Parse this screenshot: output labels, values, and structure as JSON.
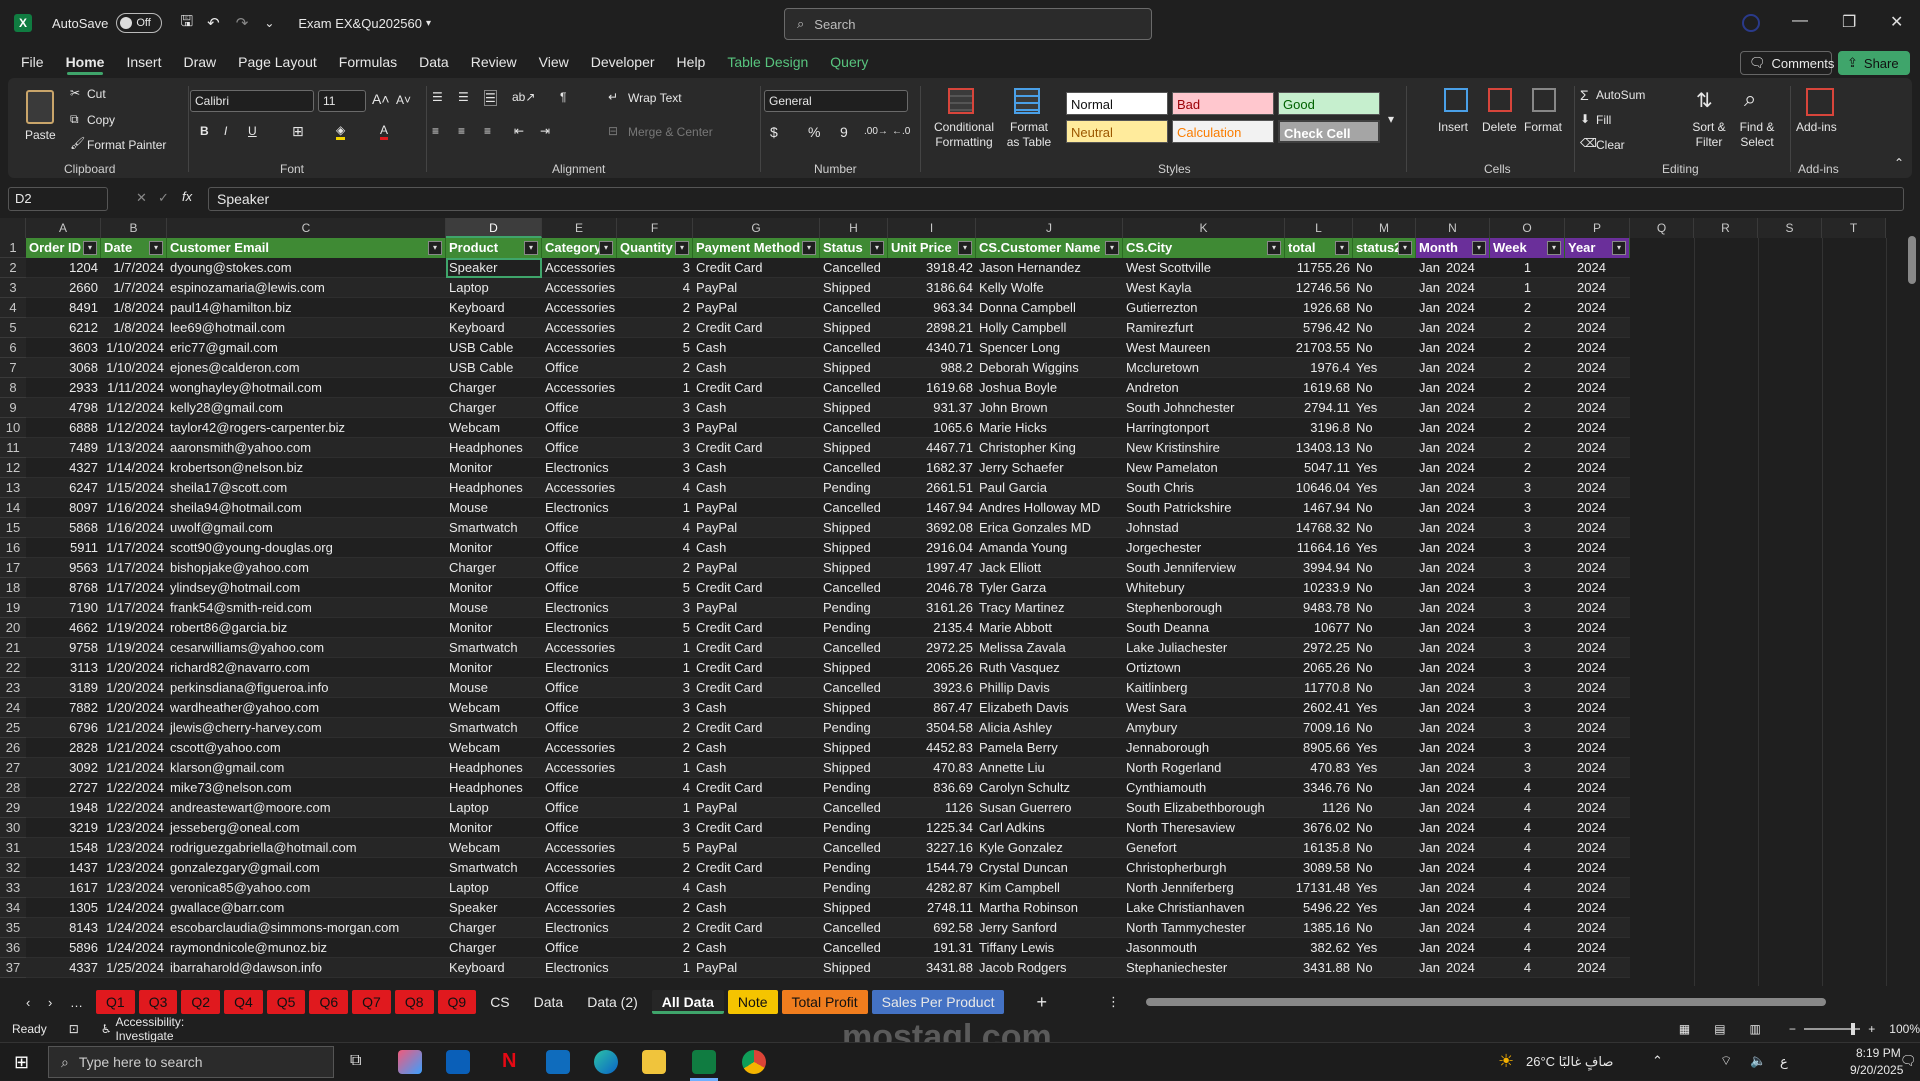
{
  "titlebar": {
    "autosave_label": "AutoSave",
    "autosave_state": "Off",
    "file_name": "Exam EX&Qu202560",
    "search_placeholder": "Search"
  },
  "menu": {
    "items": [
      "File",
      "Home",
      "Insert",
      "Draw",
      "Page Layout",
      "Formulas",
      "Data",
      "Review",
      "View",
      "Developer",
      "Help"
    ],
    "context": [
      "Table Design",
      "Query"
    ],
    "comments": "Comments",
    "share": "Share"
  },
  "ribbon": {
    "clipboard": {
      "paste": "Paste",
      "cut": "Cut",
      "copy": "Copy",
      "format_painter": "Format Painter",
      "label": "Clipboard"
    },
    "font": {
      "name": "Calibri",
      "size": "11",
      "label": "Font"
    },
    "alignment": {
      "wrap": "Wrap Text",
      "merge": "Merge & Center",
      "label": "Alignment"
    },
    "number": {
      "format": "General",
      "label": "Number"
    },
    "styles": {
      "conditional": "Conditional Formatting",
      "format_table": "Format as Table",
      "normal": "Normal",
      "bad": "Bad",
      "good": "Good",
      "neutral": "Neutral",
      "calculation": "Calculation",
      "check": "Check Cell",
      "label": "Styles"
    },
    "cells": {
      "insert": "Insert",
      "delete": "Delete",
      "format": "Format",
      "label": "Cells"
    },
    "editing": {
      "autosum": "AutoSum",
      "fill": "Fill",
      "clear": "Clear",
      "sort": "Sort & Filter",
      "find": "Find & Select",
      "label": "Editing"
    },
    "addins": {
      "addins": "Add-ins",
      "label": "Add-ins"
    }
  },
  "formula_bar": {
    "name_box": "D2",
    "formula": "Speaker"
  },
  "columns": [
    "A",
    "B",
    "C",
    "D",
    "E",
    "F",
    "G",
    "H",
    "I",
    "J",
    "K",
    "L",
    "M",
    "N",
    "O",
    "P",
    "Q",
    "R",
    "S",
    "T"
  ],
  "headers": [
    "Order ID",
    "Date",
    "Customer Email",
    "Product",
    "Category",
    "Quantity",
    "Payment Method",
    "Status",
    "Unit Price",
    "CS.Customer Name",
    "CS.City",
    "total",
    "status2",
    "Month",
    "Week",
    "Year"
  ],
  "rows": [
    [
      "1204",
      "1/7/2024",
      "dyoung@stokes.com",
      "Speaker",
      "Accessories",
      "3",
      "Credit Card",
      "Cancelled",
      "3918.42",
      "Jason Hernandez",
      "West Scottville",
      "11755.26",
      "No",
      "Jan",
      "2024",
      "1",
      "2024"
    ],
    [
      "2660",
      "1/7/2024",
      "espinozamaria@lewis.com",
      "Laptop",
      "Accessories",
      "4",
      "PayPal",
      "Shipped",
      "3186.64",
      "Kelly Wolfe",
      "West Kayla",
      "12746.56",
      "No",
      "Jan",
      "2024",
      "1",
      "2024"
    ],
    [
      "8491",
      "1/8/2024",
      "paul14@hamilton.biz",
      "Keyboard",
      "Accessories",
      "2",
      "PayPal",
      "Cancelled",
      "963.34",
      "Donna Campbell",
      "Gutierrezton",
      "1926.68",
      "No",
      "Jan",
      "2024",
      "2",
      "2024"
    ],
    [
      "6212",
      "1/8/2024",
      "lee69@hotmail.com",
      "Keyboard",
      "Accessories",
      "2",
      "Credit Card",
      "Shipped",
      "2898.21",
      "Holly Campbell",
      "Ramirezfurt",
      "5796.42",
      "No",
      "Jan",
      "2024",
      "2",
      "2024"
    ],
    [
      "3603",
      "1/10/2024",
      "eric77@gmail.com",
      "USB Cable",
      "Accessories",
      "5",
      "Cash",
      "Cancelled",
      "4340.71",
      "Spencer Long",
      "West Maureen",
      "21703.55",
      "No",
      "Jan",
      "2024",
      "2",
      "2024"
    ],
    [
      "3068",
      "1/10/2024",
      "ejones@calderon.com",
      "USB Cable",
      "Office",
      "2",
      "Cash",
      "Shipped",
      "988.2",
      "Deborah Wiggins",
      "Mccluretown",
      "1976.4",
      "Yes",
      "Jan",
      "2024",
      "2",
      "2024"
    ],
    [
      "2933",
      "1/11/2024",
      "wonghayley@hotmail.com",
      "Charger",
      "Accessories",
      "1",
      "Credit Card",
      "Cancelled",
      "1619.68",
      "Joshua Boyle",
      "Andreton",
      "1619.68",
      "No",
      "Jan",
      "2024",
      "2",
      "2024"
    ],
    [
      "4798",
      "1/12/2024",
      "kelly28@gmail.com",
      "Charger",
      "Office",
      "3",
      "Cash",
      "Shipped",
      "931.37",
      "John Brown",
      "South Johnchester",
      "2794.11",
      "Yes",
      "Jan",
      "2024",
      "2",
      "2024"
    ],
    [
      "6888",
      "1/12/2024",
      "taylor42@rogers-carpenter.biz",
      "Webcam",
      "Office",
      "3",
      "PayPal",
      "Cancelled",
      "1065.6",
      "Marie Hicks",
      "Harringtonport",
      "3196.8",
      "No",
      "Jan",
      "2024",
      "2",
      "2024"
    ],
    [
      "7489",
      "1/13/2024",
      "aaronsmith@yahoo.com",
      "Headphones",
      "Office",
      "3",
      "Credit Card",
      "Shipped",
      "4467.71",
      "Christopher King",
      "New Kristinshire",
      "13403.13",
      "No",
      "Jan",
      "2024",
      "2",
      "2024"
    ],
    [
      "4327",
      "1/14/2024",
      "krobertson@nelson.biz",
      "Monitor",
      "Electronics",
      "3",
      "Cash",
      "Cancelled",
      "1682.37",
      "Jerry Schaefer",
      "New Pamelaton",
      "5047.11",
      "Yes",
      "Jan",
      "2024",
      "2",
      "2024"
    ],
    [
      "6247",
      "1/15/2024",
      "sheila17@scott.com",
      "Headphones",
      "Accessories",
      "4",
      "Cash",
      "Pending",
      "2661.51",
      "Paul Garcia",
      "South Chris",
      "10646.04",
      "Yes",
      "Jan",
      "2024",
      "3",
      "2024"
    ],
    [
      "8097",
      "1/16/2024",
      "sheila94@hotmail.com",
      "Mouse",
      "Electronics",
      "1",
      "PayPal",
      "Cancelled",
      "1467.94",
      "Andres Holloway MD",
      "South Patrickshire",
      "1467.94",
      "No",
      "Jan",
      "2024",
      "3",
      "2024"
    ],
    [
      "5868",
      "1/16/2024",
      "uwolf@gmail.com",
      "Smartwatch",
      "Office",
      "4",
      "PayPal",
      "Shipped",
      "3692.08",
      "Erica Gonzales MD",
      "Johnstad",
      "14768.32",
      "No",
      "Jan",
      "2024",
      "3",
      "2024"
    ],
    [
      "5911",
      "1/17/2024",
      "scott90@young-douglas.org",
      "Monitor",
      "Office",
      "4",
      "Cash",
      "Shipped",
      "2916.04",
      "Amanda Young",
      "Jorgechester",
      "11664.16",
      "Yes",
      "Jan",
      "2024",
      "3",
      "2024"
    ],
    [
      "9563",
      "1/17/2024",
      "bishopjake@yahoo.com",
      "Charger",
      "Office",
      "2",
      "PayPal",
      "Shipped",
      "1997.47",
      "Jack Elliott",
      "South Jenniferview",
      "3994.94",
      "No",
      "Jan",
      "2024",
      "3",
      "2024"
    ],
    [
      "8768",
      "1/17/2024",
      "ylindsey@hotmail.com",
      "Monitor",
      "Office",
      "5",
      "Credit Card",
      "Cancelled",
      "2046.78",
      "Tyler Garza",
      "Whitebury",
      "10233.9",
      "No",
      "Jan",
      "2024",
      "3",
      "2024"
    ],
    [
      "7190",
      "1/17/2024",
      "frank54@smith-reid.com",
      "Mouse",
      "Electronics",
      "3",
      "PayPal",
      "Pending",
      "3161.26",
      "Tracy Martinez",
      "Stephenborough",
      "9483.78",
      "No",
      "Jan",
      "2024",
      "3",
      "2024"
    ],
    [
      "4662",
      "1/19/2024",
      "robert86@garcia.biz",
      "Monitor",
      "Electronics",
      "5",
      "Credit Card",
      "Pending",
      "2135.4",
      "Marie Abbott",
      "South Deanna",
      "10677",
      "No",
      "Jan",
      "2024",
      "3",
      "2024"
    ],
    [
      "9758",
      "1/19/2024",
      "cesarwilliams@yahoo.com",
      "Smartwatch",
      "Accessories",
      "1",
      "Credit Card",
      "Cancelled",
      "2972.25",
      "Melissa Zavala",
      "Lake Juliachester",
      "2972.25",
      "No",
      "Jan",
      "2024",
      "3",
      "2024"
    ],
    [
      "3113",
      "1/20/2024",
      "richard82@navarro.com",
      "Monitor",
      "Electronics",
      "1",
      "Credit Card",
      "Shipped",
      "2065.26",
      "Ruth Vasquez",
      "Ortiztown",
      "2065.26",
      "No",
      "Jan",
      "2024",
      "3",
      "2024"
    ],
    [
      "3189",
      "1/20/2024",
      "perkinsdiana@figueroa.info",
      "Mouse",
      "Office",
      "3",
      "Credit Card",
      "Cancelled",
      "3923.6",
      "Phillip Davis",
      "Kaitlinberg",
      "11770.8",
      "No",
      "Jan",
      "2024",
      "3",
      "2024"
    ],
    [
      "7882",
      "1/20/2024",
      "wardheather@yahoo.com",
      "Webcam",
      "Office",
      "3",
      "Cash",
      "Shipped",
      "867.47",
      "Elizabeth Davis",
      "West Sara",
      "2602.41",
      "Yes",
      "Jan",
      "2024",
      "3",
      "2024"
    ],
    [
      "6796",
      "1/21/2024",
      "jlewis@cherry-harvey.com",
      "Smartwatch",
      "Office",
      "2",
      "Credit Card",
      "Pending",
      "3504.58",
      "Alicia Ashley",
      "Amybury",
      "7009.16",
      "No",
      "Jan",
      "2024",
      "3",
      "2024"
    ],
    [
      "2828",
      "1/21/2024",
      "cscott@yahoo.com",
      "Webcam",
      "Accessories",
      "2",
      "Cash",
      "Shipped",
      "4452.83",
      "Pamela Berry",
      "Jennaborough",
      "8905.66",
      "Yes",
      "Jan",
      "2024",
      "3",
      "2024"
    ],
    [
      "3092",
      "1/21/2024",
      "klarson@gmail.com",
      "Headphones",
      "Accessories",
      "1",
      "Cash",
      "Shipped",
      "470.83",
      "Annette Liu",
      "North Rogerland",
      "470.83",
      "Yes",
      "Jan",
      "2024",
      "3",
      "2024"
    ],
    [
      "2727",
      "1/22/2024",
      "mike73@nelson.com",
      "Headphones",
      "Office",
      "4",
      "Credit Card",
      "Pending",
      "836.69",
      "Carolyn Schultz",
      "Cynthiamouth",
      "3346.76",
      "No",
      "Jan",
      "2024",
      "4",
      "2024"
    ],
    [
      "1948",
      "1/22/2024",
      "andreastewart@moore.com",
      "Laptop",
      "Office",
      "1",
      "PayPal",
      "Cancelled",
      "1126",
      "Susan Guerrero",
      "South Elizabethborough",
      "1126",
      "No",
      "Jan",
      "2024",
      "4",
      "2024"
    ],
    [
      "3219",
      "1/23/2024",
      "jesseberg@oneal.com",
      "Monitor",
      "Office",
      "3",
      "Credit Card",
      "Pending",
      "1225.34",
      "Carl Adkins",
      "North Theresaview",
      "3676.02",
      "No",
      "Jan",
      "2024",
      "4",
      "2024"
    ],
    [
      "1548",
      "1/23/2024",
      "rodriguezgabriella@hotmail.com",
      "Webcam",
      "Accessories",
      "5",
      "PayPal",
      "Cancelled",
      "3227.16",
      "Kyle Gonzalez",
      "Genefort",
      "16135.8",
      "No",
      "Jan",
      "2024",
      "4",
      "2024"
    ],
    [
      "1437",
      "1/23/2024",
      "gonzalezgary@gmail.com",
      "Smartwatch",
      "Accessories",
      "2",
      "Credit Card",
      "Pending",
      "1544.79",
      "Crystal Duncan",
      "Christopherburgh",
      "3089.58",
      "No",
      "Jan",
      "2024",
      "4",
      "2024"
    ],
    [
      "1617",
      "1/23/2024",
      "veronica85@yahoo.com",
      "Laptop",
      "Office",
      "4",
      "Cash",
      "Pending",
      "4282.87",
      "Kim Campbell",
      "North Jenniferberg",
      "17131.48",
      "Yes",
      "Jan",
      "2024",
      "4",
      "2024"
    ],
    [
      "1305",
      "1/24/2024",
      "gwallace@barr.com",
      "Speaker",
      "Accessories",
      "2",
      "Cash",
      "Shipped",
      "2748.11",
      "Martha Robinson",
      "Lake Christianhaven",
      "5496.22",
      "Yes",
      "Jan",
      "2024",
      "4",
      "2024"
    ],
    [
      "8143",
      "1/24/2024",
      "escobarclaudia@simmons-morgan.com",
      "Charger",
      "Electronics",
      "2",
      "Credit Card",
      "Cancelled",
      "692.58",
      "Jerry Sanford",
      "North Tammychester",
      "1385.16",
      "No",
      "Jan",
      "2024",
      "4",
      "2024"
    ],
    [
      "5896",
      "1/24/2024",
      "raymondnicole@munoz.biz",
      "Charger",
      "Office",
      "2",
      "Cash",
      "Cancelled",
      "191.31",
      "Tiffany Lewis",
      "Jasonmouth",
      "382.62",
      "Yes",
      "Jan",
      "2024",
      "4",
      "2024"
    ],
    [
      "4337",
      "1/25/2024",
      "ibarraharold@dawson.info",
      "Keyboard",
      "Electronics",
      "1",
      "PayPal",
      "Shipped",
      "3431.88",
      "Jacob Rodgers",
      "Stephaniechester",
      "3431.88",
      "No",
      "Jan",
      "2024",
      "4",
      "2024"
    ]
  ],
  "sheet_tabs": [
    "Q1",
    "Q3",
    "Q2",
    "Q4",
    "Q5",
    "Q6",
    "Q7",
    "Q8",
    "Q9",
    "CS",
    "Data",
    "Data (2)",
    "All Data",
    "Note",
    "Total Profit",
    "Sales Per Product"
  ],
  "status": {
    "ready": "Ready",
    "accessibility": "Accessibility: Investigate",
    "zoom": "100%"
  },
  "taskbar": {
    "search_placeholder": "Type here to search",
    "weather": "26°C صافٍ غالبًا",
    "lang": "ع",
    "time": "8:19 PM",
    "date": "9/20/2025"
  },
  "watermark": "mostaql.com"
}
